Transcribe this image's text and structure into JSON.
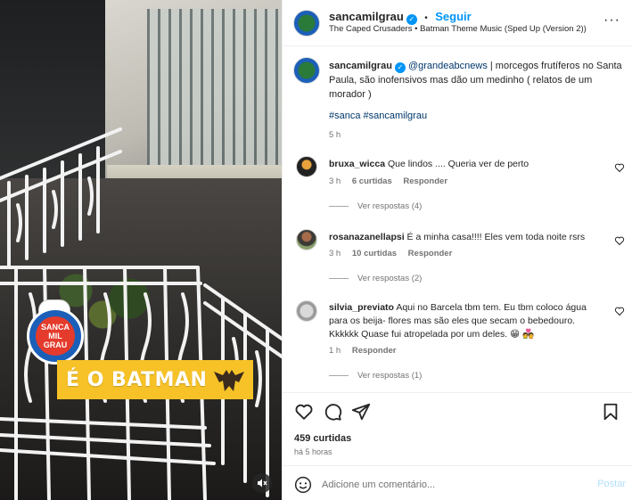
{
  "video": {
    "sticker_text": "É O BATMAN",
    "logo_text": "SANCA MIL GRAU"
  },
  "header": {
    "username": "sancamilgrau",
    "dot": "•",
    "follow_label": "Seguir",
    "audio": "The Caped Crusaders • Batman Theme Music (Sped Up (Version 2))",
    "more": "···"
  },
  "caption": {
    "username": "sancamilgrau",
    "mention": "@grandeabcnews",
    "text": " | morcegos frutíferos no Santa Paula, são inofensivos mas dão um medinho ( relatos de um morador )",
    "hashtags": "#sanca #sancamilgrau",
    "time": "5 h"
  },
  "comments": [
    {
      "username": "bruxa_wicca",
      "text": "Que lindos .... Queria ver de perto",
      "time": "3 h",
      "likes": "6 curtidas",
      "reply_label": "Responder",
      "view_replies": "Ver respostas (4)"
    },
    {
      "username": "rosanazanellapsi",
      "text": "É a minha casa!!!! Eles vem toda noite rsrs",
      "time": "3 h",
      "likes": "10 curtidas",
      "reply_label": "Responder",
      "view_replies": "Ver respostas (2)"
    },
    {
      "username": "silvia_previato",
      "text": "Aqui no Barcela tbm tem. Eu tbm coloco água para os beija- flores mas são eles que secam o bebedouro. Kkkkkk Quase fui atropelada por um deles. 😁 💑",
      "time": "1 h",
      "likes": "",
      "reply_label": "Responder",
      "view_replies": "Ver respostas (1)"
    }
  ],
  "footer": {
    "likes": "459 curtidas",
    "time": "há 5 horas",
    "comment_placeholder": "Adicione um comentário...",
    "post_label": "Postar"
  },
  "colors": {
    "link_blue": "#0095f6",
    "sticker_yellow": "#f6c227"
  }
}
